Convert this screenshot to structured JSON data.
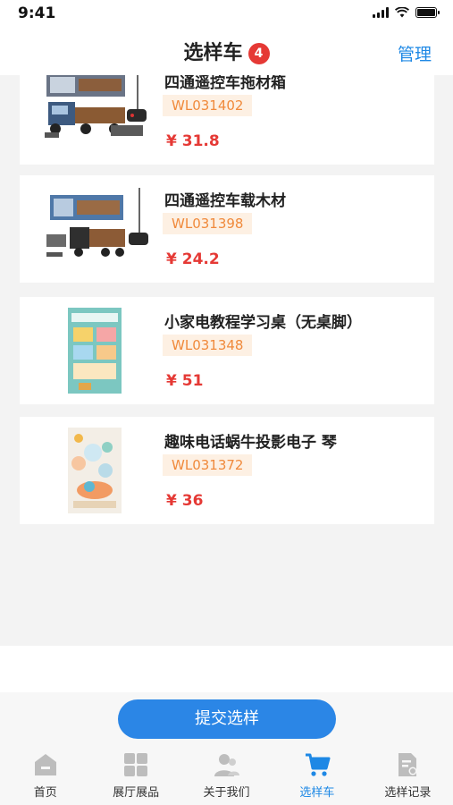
{
  "status": {
    "time": "9:41"
  },
  "header": {
    "title": "选样车",
    "count": "4",
    "manage": "管理"
  },
  "items": [
    {
      "title": "四通遥控车拖材箱",
      "sku": "WL031402",
      "price": "¥ 31.8",
      "thumb": "rc-truck-log-trailer-image"
    },
    {
      "title": "四通遥控车载木材",
      "sku": "WL031398",
      "price": "¥ 24.2",
      "thumb": "rc-truck-timber-image"
    },
    {
      "title": "小家电教程学习桌（无桌脚）",
      "sku": "WL031348",
      "price": "¥ 51",
      "thumb": "learning-desk-box-image"
    },
    {
      "title": "趣味电话蜗牛投影电子 琴",
      "sku": "WL031372",
      "price": "¥ 36",
      "thumb": "snail-phone-piano-image"
    }
  ],
  "submit": {
    "label": "提交选样"
  },
  "tabs": [
    {
      "label": "首页",
      "icon": "home-icon",
      "active": false
    },
    {
      "label": "展厅展品",
      "icon": "grid-icon",
      "active": false
    },
    {
      "label": "关于我们",
      "icon": "people-icon",
      "active": false
    },
    {
      "label": "选样车",
      "icon": "cart-icon",
      "active": true
    },
    {
      "label": "选样记录",
      "icon": "record-icon",
      "active": false
    }
  ],
  "colors": {
    "accent": "#1e88e5",
    "price": "#e53935",
    "sku_text": "#f08a3c",
    "sku_bg": "#fdf0e3",
    "badge": "#e53935"
  }
}
